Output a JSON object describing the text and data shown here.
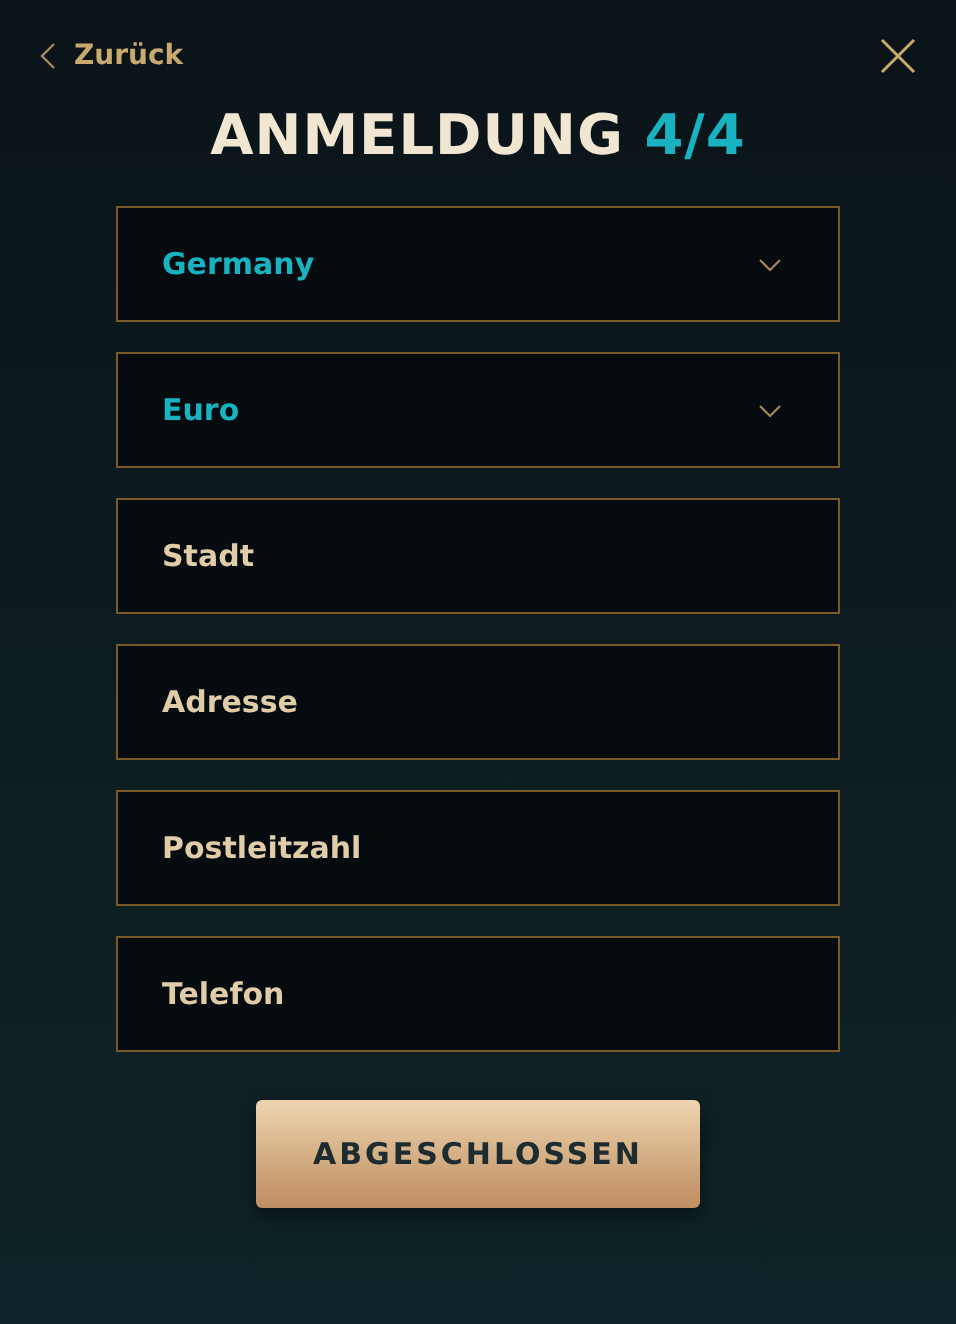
{
  "header": {
    "back": "Zurück",
    "title": "ANMELDUNG",
    "step": "4/4"
  },
  "fields": [
    {
      "kind": "select",
      "value": "Germany"
    },
    {
      "kind": "select",
      "value": "Euro"
    },
    {
      "kind": "text",
      "placeholder": "Stadt"
    },
    {
      "kind": "text",
      "placeholder": "Adresse"
    },
    {
      "kind": "text",
      "placeholder": "Postleitzahl"
    },
    {
      "kind": "text",
      "placeholder": "Telefon"
    }
  ],
  "submit": "ABGESCHLOSSEN"
}
